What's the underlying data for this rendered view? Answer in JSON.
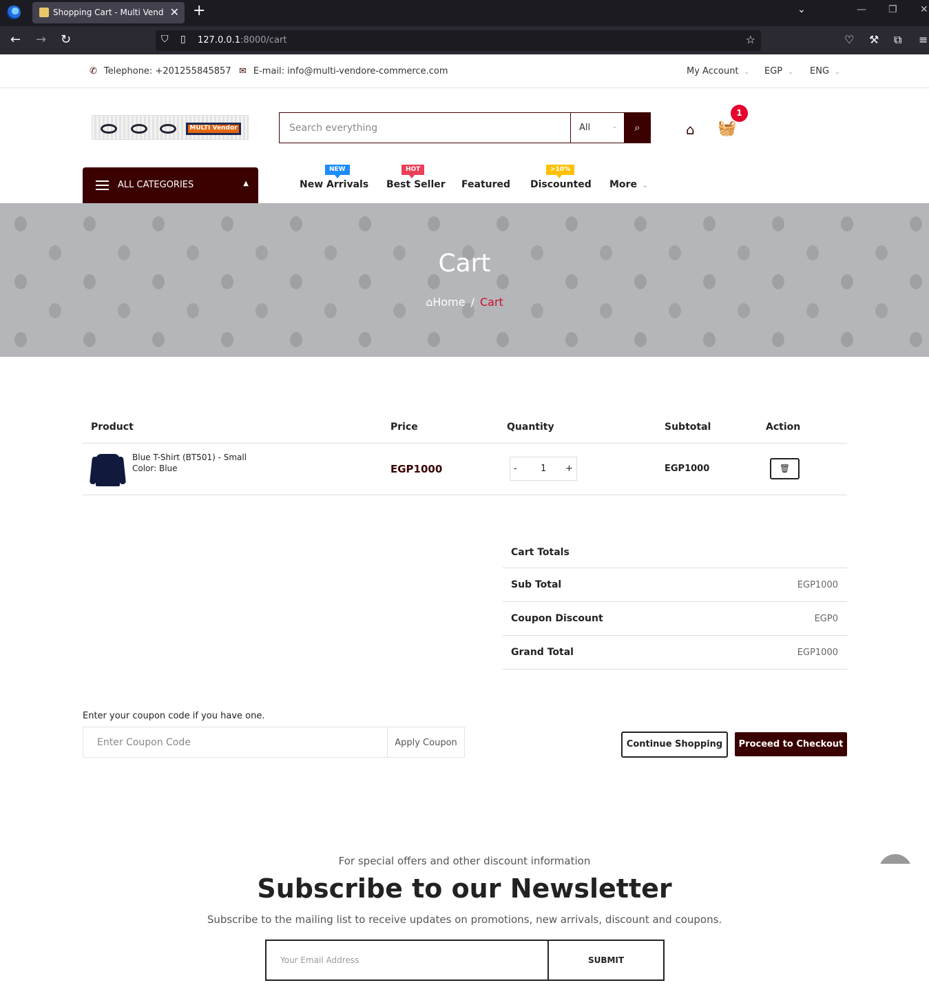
{
  "browser": {
    "tab_title": "Shopping Cart - Multi Vendor E",
    "url_host": "127.0.0.1",
    "url_rest": ":8000/cart"
  },
  "topbar": {
    "phone": "Telephone: +201255845857",
    "email": "E-mail: info@multi-vendore-commerce.com",
    "account": "My Account",
    "currency": "EGP",
    "language": "ENG"
  },
  "header": {
    "logo_text": "MULTI Vendor",
    "search_placeholder": "Search everything",
    "search_category": "All",
    "cart_count": "1"
  },
  "nav": {
    "all_categories": "ALL CATEGORIES",
    "items": [
      {
        "label": "New Arrivals",
        "badge": "NEW"
      },
      {
        "label": "Best Seller",
        "badge": "HOT"
      },
      {
        "label": "Featured",
        "badge": ""
      },
      {
        "label": "Discounted",
        "badge": ">10%"
      },
      {
        "label": "More",
        "badge": ""
      }
    ]
  },
  "hero": {
    "title": "Cart",
    "breadcrumb_home": "Home",
    "breadcrumb_sep": "/",
    "breadcrumb_current": "Cart"
  },
  "table": {
    "headers": [
      "Product",
      "Price",
      "Quantity",
      "Subtotal",
      "Action"
    ],
    "rows": [
      {
        "name": "Blue T-Shirt (BT501) - Small",
        "color": "Color: Blue",
        "price": "EGP1000",
        "qty": "1",
        "minus": "-",
        "plus": "+",
        "subtotal": "EGP1000"
      }
    ]
  },
  "totals": {
    "title": "Cart Totals",
    "sub_total_label": "Sub Total",
    "sub_total": "EGP1000",
    "coupon_label": "Coupon Discount",
    "coupon": "EGP0",
    "grand_label": "Grand Total",
    "grand": "EGP1000"
  },
  "coupon": {
    "hint": "Enter your coupon code if you have one.",
    "placeholder": "Enter Coupon Code",
    "apply": "Apply Coupon"
  },
  "actions": {
    "continue": "Continue Shopping",
    "checkout": "Proceed to Checkout"
  },
  "newsletter": {
    "pre": "For special offers and other discount information",
    "title": "Subscribe to our Newsletter",
    "desc": "Subscribe to the mailing list to receive updates on promotions, new arrivals, discount and coupons.",
    "placeholder": "Your Email Address",
    "submit": "SUBMIT"
  },
  "colors": {
    "brand": "#3b0000",
    "accent_red": "#c8102e",
    "badge_new": "#1c8cff",
    "badge_hot": "#e94058",
    "badge_discount": "#ffc107"
  }
}
